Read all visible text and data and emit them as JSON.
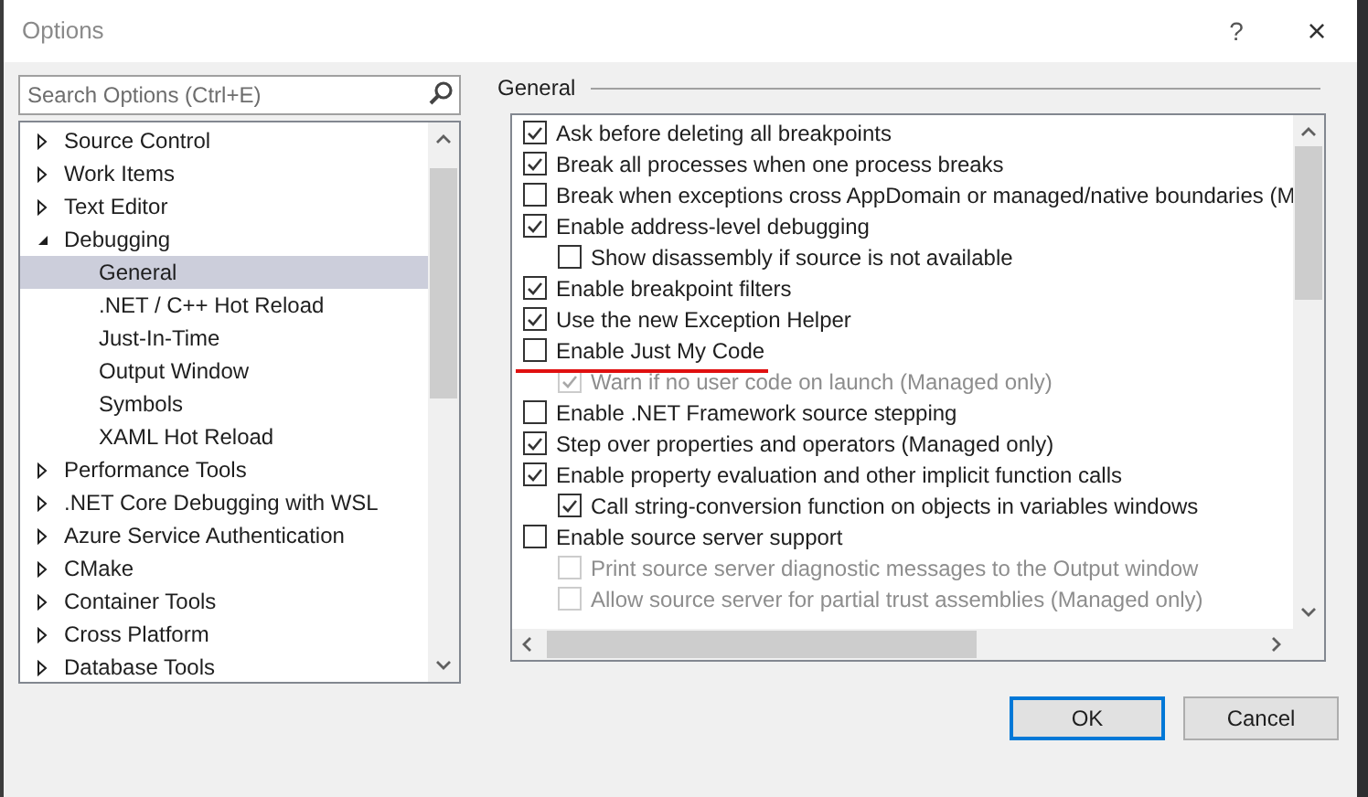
{
  "window": {
    "title": "Options",
    "help": "?",
    "close": "×"
  },
  "search": {
    "placeholder": "Search Options (Ctrl+E)"
  },
  "tree": [
    {
      "label": "Source Control",
      "expanded": false,
      "selected": false
    },
    {
      "label": "Work Items",
      "expanded": false,
      "selected": false
    },
    {
      "label": "Text Editor",
      "expanded": false,
      "selected": false
    },
    {
      "label": "Debugging",
      "expanded": true,
      "selected": false,
      "children": [
        {
          "label": "General",
          "selected": true
        },
        {
          "label": ".NET / C++ Hot Reload",
          "selected": false
        },
        {
          "label": "Just-In-Time",
          "selected": false
        },
        {
          "label": "Output Window",
          "selected": false
        },
        {
          "label": "Symbols",
          "selected": false
        },
        {
          "label": "XAML Hot Reload",
          "selected": false
        }
      ]
    },
    {
      "label": "Performance Tools",
      "expanded": false,
      "selected": false
    },
    {
      "label": ".NET Core Debugging with WSL",
      "expanded": false,
      "selected": false
    },
    {
      "label": "Azure Service Authentication",
      "expanded": false,
      "selected": false
    },
    {
      "label": "CMake",
      "expanded": false,
      "selected": false
    },
    {
      "label": "Container Tools",
      "expanded": false,
      "selected": false
    },
    {
      "label": "Cross Platform",
      "expanded": false,
      "selected": false
    },
    {
      "label": "Database Tools",
      "expanded": false,
      "selected": false
    }
  ],
  "section": {
    "title": "General"
  },
  "options": [
    {
      "label": "Ask before deleting all breakpoints",
      "checked": true,
      "disabled": false,
      "underlined": false
    },
    {
      "label": "Break all processes when one process breaks",
      "checked": true,
      "disabled": false,
      "underlined": false
    },
    {
      "label": "Break when exceptions cross AppDomain or managed/native boundaries (M",
      "checked": false,
      "disabled": false,
      "underlined": false
    },
    {
      "label": "Enable address-level debugging",
      "checked": true,
      "disabled": false,
      "underlined": false,
      "children": [
        {
          "label": "Show disassembly if source is not available",
          "checked": false,
          "disabled": false,
          "underlined": false
        }
      ]
    },
    {
      "label": "Enable breakpoint filters",
      "checked": true,
      "disabled": false,
      "underlined": false
    },
    {
      "label": "Use the new Exception Helper",
      "checked": true,
      "disabled": false,
      "underlined": false
    },
    {
      "label": "Enable Just My Code",
      "checked": false,
      "disabled": false,
      "underlined": true,
      "children": [
        {
          "label": "Warn if no user code on launch (Managed only)",
          "checked": true,
          "disabled": true,
          "underlined": false
        }
      ]
    },
    {
      "label": "Enable .NET Framework source stepping",
      "checked": false,
      "disabled": false,
      "underlined": false
    },
    {
      "label": "Step over properties and operators (Managed only)",
      "checked": true,
      "disabled": false,
      "underlined": false
    },
    {
      "label": "Enable property evaluation and other implicit function calls",
      "checked": true,
      "disabled": false,
      "underlined": false,
      "children": [
        {
          "label": "Call string-conversion function on objects in variables windows",
          "checked": true,
          "disabled": false,
          "underlined": false
        }
      ]
    },
    {
      "label": "Enable source server support",
      "checked": false,
      "disabled": false,
      "underlined": false,
      "children": [
        {
          "label": "Print source server diagnostic messages to the Output window",
          "checked": false,
          "disabled": true,
          "underlined": false
        },
        {
          "label": "Allow source server for partial trust assemblies (Managed only)",
          "checked": false,
          "disabled": true,
          "underlined": false
        }
      ]
    }
  ],
  "buttons": [
    {
      "label": "OK",
      "default": true
    },
    {
      "label": "Cancel",
      "default": false
    }
  ]
}
